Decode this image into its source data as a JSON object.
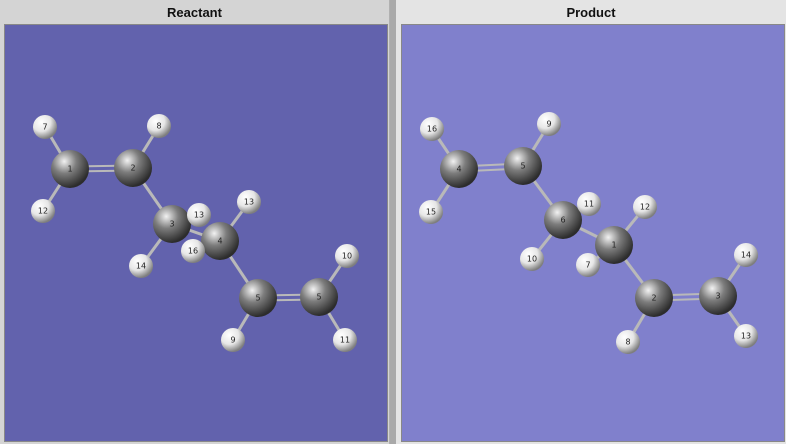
{
  "panels": [
    {
      "key": "reactant",
      "title": "Reactant",
      "atoms": [
        {
          "id": "1",
          "el": "C"
        },
        {
          "id": "2",
          "el": "C"
        },
        {
          "id": "3",
          "el": "C"
        },
        {
          "id": "4",
          "el": "C"
        },
        {
          "id": "5",
          "el": "C"
        },
        {
          "id": "5",
          "el": "C"
        },
        {
          "id": "7",
          "el": "H"
        },
        {
          "id": "8",
          "el": "H"
        },
        {
          "id": "12",
          "el": "H"
        },
        {
          "id": "13",
          "el": "H"
        },
        {
          "id": "13",
          "el": "H"
        },
        {
          "id": "14",
          "el": "H"
        },
        {
          "id": "16",
          "el": "H"
        },
        {
          "id": "10",
          "el": "H"
        },
        {
          "id": "9",
          "el": "H"
        },
        {
          "id": "11",
          "el": "H"
        }
      ]
    },
    {
      "key": "product",
      "title": "Product",
      "atoms": [
        {
          "id": "4",
          "el": "C"
        },
        {
          "id": "5",
          "el": "C"
        },
        {
          "id": "6",
          "el": "C"
        },
        {
          "id": "1",
          "el": "C"
        },
        {
          "id": "2",
          "el": "C"
        },
        {
          "id": "3",
          "el": "C"
        },
        {
          "id": "16",
          "el": "H"
        },
        {
          "id": "9",
          "el": "H"
        },
        {
          "id": "15",
          "el": "H"
        },
        {
          "id": "11",
          "el": "H"
        },
        {
          "id": "12",
          "el": "H"
        },
        {
          "id": "10",
          "el": "H"
        },
        {
          "id": "7",
          "el": "H"
        },
        {
          "id": "14",
          "el": "H"
        },
        {
          "id": "8",
          "el": "H"
        },
        {
          "id": "13",
          "el": "H"
        }
      ]
    }
  ],
  "colors": {
    "carbon": "#7d7d7d",
    "hydrogen": "#e6e6e6",
    "bond": "#b9b9b9"
  }
}
